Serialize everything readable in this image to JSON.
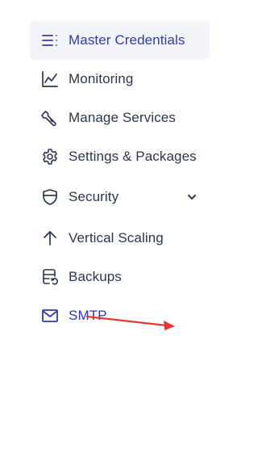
{
  "sidebar": {
    "items": [
      {
        "label": "Master Credentials",
        "icon": "list-menu-icon",
        "active": true
      },
      {
        "label": "Monitoring",
        "icon": "line-chart-icon"
      },
      {
        "label": "Manage Services",
        "icon": "wrench-icon"
      },
      {
        "label": "Settings & Packages",
        "icon": "gear-icon"
      },
      {
        "label": "Security",
        "icon": "shield-icon",
        "expandable": true,
        "chevron_icon": "chevron-down-icon"
      },
      {
        "label": "Vertical Scaling",
        "icon": "arrow-up-icon"
      },
      {
        "label": "Backups",
        "icon": "backup-icon"
      },
      {
        "label": "SMTP",
        "icon": "mail-icon"
      }
    ]
  },
  "annotation": {
    "icon": "red-arrow-annotation",
    "color": "#e53935"
  },
  "colors": {
    "active_bg": "#f3f4fa",
    "accent": "#2f3da8",
    "text": "#2b3652",
    "icon": "#2b3652"
  }
}
